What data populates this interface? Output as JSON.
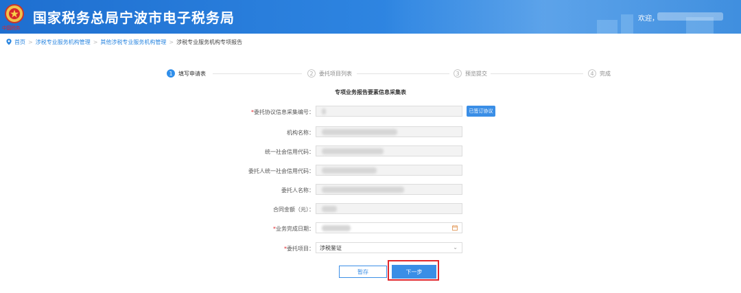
{
  "header": {
    "title": "国家税务总局宁波市电子税务局",
    "emblem_caption": "中国税务",
    "welcome": "欢迎，"
  },
  "breadcrumb": {
    "items": [
      "首页",
      "涉税专业服务机构管理",
      "其他涉税专业服务机构管理",
      "涉税专业服务机构专项报告"
    ]
  },
  "steps": [
    {
      "num": "1",
      "label": "填写申请表",
      "active": true
    },
    {
      "num": "2",
      "label": "委托项目列表",
      "active": false
    },
    {
      "num": "3",
      "label": "预览提交",
      "active": false
    },
    {
      "num": "4",
      "label": "完成",
      "active": false
    }
  ],
  "form": {
    "title": "专项业务报告要素信息采集表",
    "required_mark": "*",
    "fields": [
      {
        "label": "委托协议信息采集编号：",
        "required": true
      },
      {
        "label": "机构名称：",
        "required": false
      },
      {
        "label": "统一社会信用代码：",
        "required": false
      },
      {
        "label": "委托人统一社会信用代码：",
        "required": false
      },
      {
        "label": "委托人名称：",
        "required": false
      },
      {
        "label": "合同金额（元）：",
        "required": false
      },
      {
        "label": "业务完成日期：",
        "required": true
      },
      {
        "label": "委托项目：",
        "required": true,
        "value": "涉税鉴证"
      }
    ],
    "sign_button": "已签订协议",
    "save_button": "暂存",
    "next_button": "下一步"
  },
  "colors": {
    "header_bg": "#2f86e2",
    "accent": "#3a8ee6",
    "required": "#e0262b",
    "highlight": "#e1262b"
  },
  "icons": [
    "national-tax-emblem-icon",
    "location-pin-icon",
    "calendar-icon",
    "chevron-down-icon"
  ]
}
